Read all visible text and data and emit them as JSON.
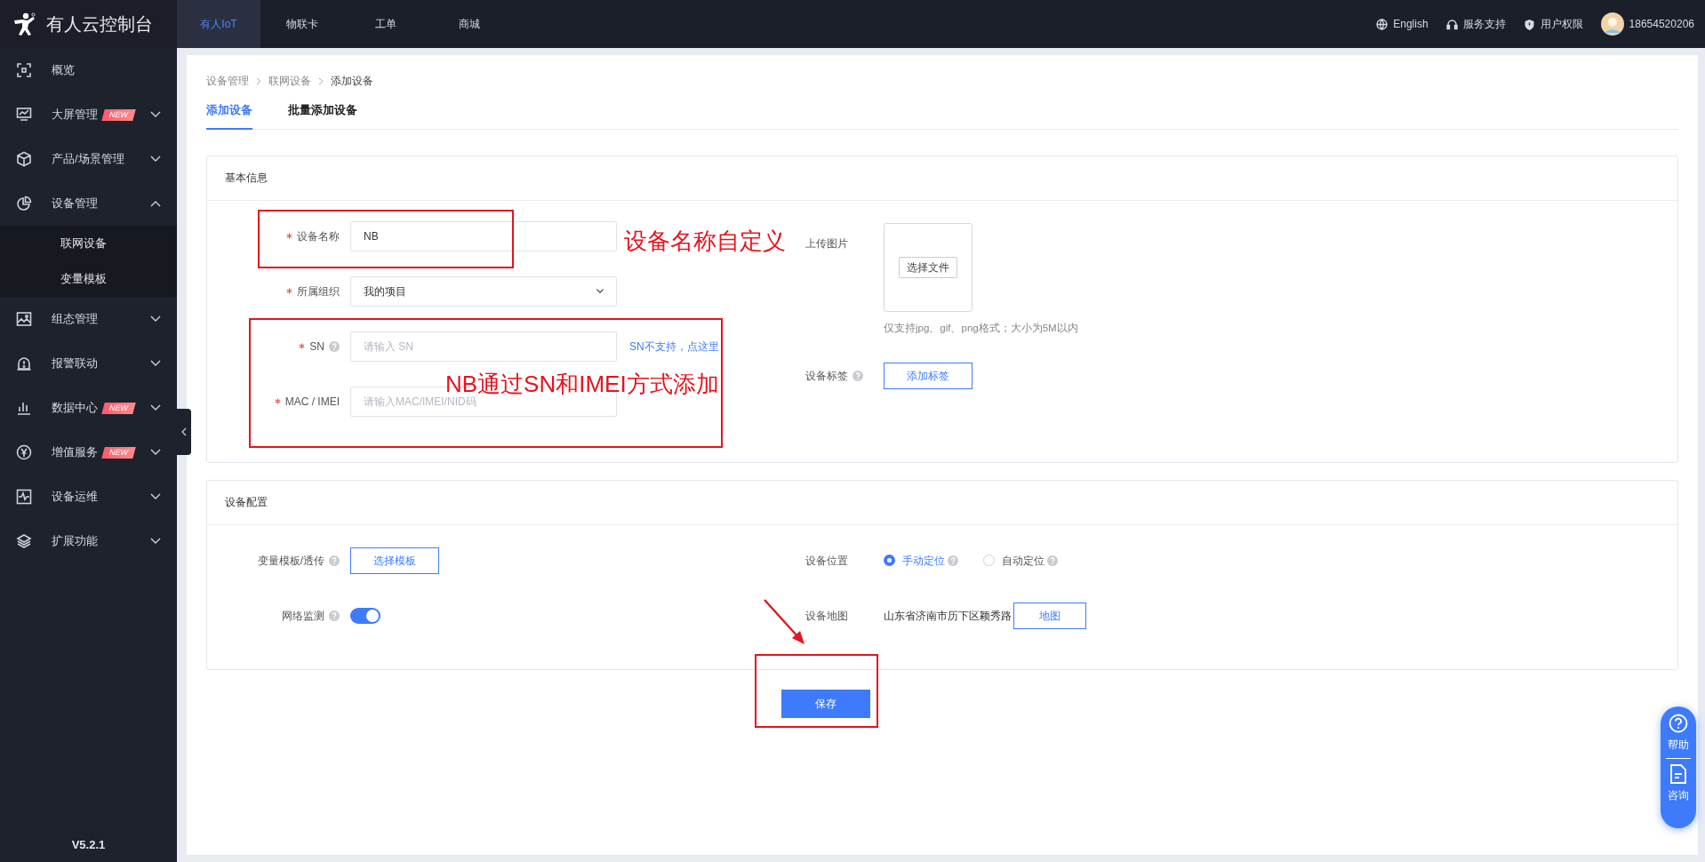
{
  "sidebar": {
    "logo_text": "有人云控制台",
    "items": [
      {
        "label": "概览"
      },
      {
        "label": "大屏管理",
        "badge": "NEW",
        "expanded": false
      },
      {
        "label": "产品/场景管理",
        "expanded": false
      },
      {
        "label": "设备管理",
        "expanded": true,
        "children": [
          {
            "label": "联网设备"
          },
          {
            "label": "变量模板"
          }
        ]
      },
      {
        "label": "组态管理",
        "expanded": false
      },
      {
        "label": "报警联动",
        "expanded": false
      },
      {
        "label": "数据中心",
        "badge": "NEW",
        "expanded": false
      },
      {
        "label": "增值服务",
        "badge": "NEW",
        "expanded": false
      },
      {
        "label": "设备运维",
        "expanded": false
      },
      {
        "label": "扩展功能",
        "expanded": false
      }
    ],
    "version": "V5.2.1"
  },
  "top_nav": {
    "tabs": [
      {
        "label": "有人IoT",
        "selected": true
      },
      {
        "label": "物联卡",
        "selected": false
      },
      {
        "label": "工单",
        "selected": false
      },
      {
        "label": "商城",
        "selected": false
      }
    ],
    "links": [
      {
        "label": "English"
      },
      {
        "label": "服务支持"
      },
      {
        "label": "用户权限"
      }
    ],
    "user": "18654520206"
  },
  "breadcrumb": [
    "设备管理",
    "联网设备",
    "添加设备"
  ],
  "tabs": [
    {
      "label": "添加设备",
      "selected": true
    },
    {
      "label": "批量添加设备",
      "selected": false
    }
  ],
  "sections": [
    {
      "title": "基本信息",
      "left": [
        {
          "kind": "input",
          "label": "设备名称",
          "required": true,
          "value": "NB"
        },
        {
          "kind": "select",
          "label": "所属组织",
          "required": true,
          "value": "我的项目"
        },
        {
          "kind": "input",
          "label": "SN",
          "required": true,
          "help": true,
          "placeholder": "请输入 SN",
          "link": "SN不支持，点这里"
        },
        {
          "kind": "input",
          "label": "MAC / IMEI",
          "required": true,
          "placeholder": "请输入MAC/IMEI/NID码"
        }
      ],
      "right": [
        {
          "kind": "upload",
          "label": "上传图片",
          "button": "选择文件",
          "hint": "仅支持jpg、gif、png格式；大小为5M以内"
        },
        {
          "kind": "button",
          "label": "设备标签",
          "help": true,
          "button": "添加标签"
        }
      ]
    },
    {
      "title": "设备配置",
      "left": [
        {
          "kind": "button",
          "label": "变量模板/透传",
          "help": true,
          "button": "选择模板"
        },
        {
          "kind": "toggle",
          "label": "网络监测",
          "help": true,
          "on": true
        }
      ],
      "right": [
        {
          "kind": "radio",
          "label": "设备位置",
          "options": [
            {
              "label": "手动定位",
              "selected": true,
              "help": true
            },
            {
              "label": "自动定位",
              "selected": false,
              "help": true
            }
          ]
        },
        {
          "kind": "address",
          "label": "设备地图",
          "value": "山东省济南市历下区颖秀路",
          "button": "地图"
        }
      ]
    }
  ],
  "save_button": "保存",
  "help_widget": [
    {
      "label": "帮助"
    },
    {
      "label": "咨询"
    }
  ],
  "annotations": [
    {
      "kind": "box"
    },
    {
      "kind": "text",
      "text": "设备名称自定义"
    },
    {
      "kind": "box"
    },
    {
      "kind": "text",
      "text": "NB通过SN和IMEI方式添加"
    },
    {
      "kind": "arrow"
    },
    {
      "kind": "box"
    }
  ]
}
